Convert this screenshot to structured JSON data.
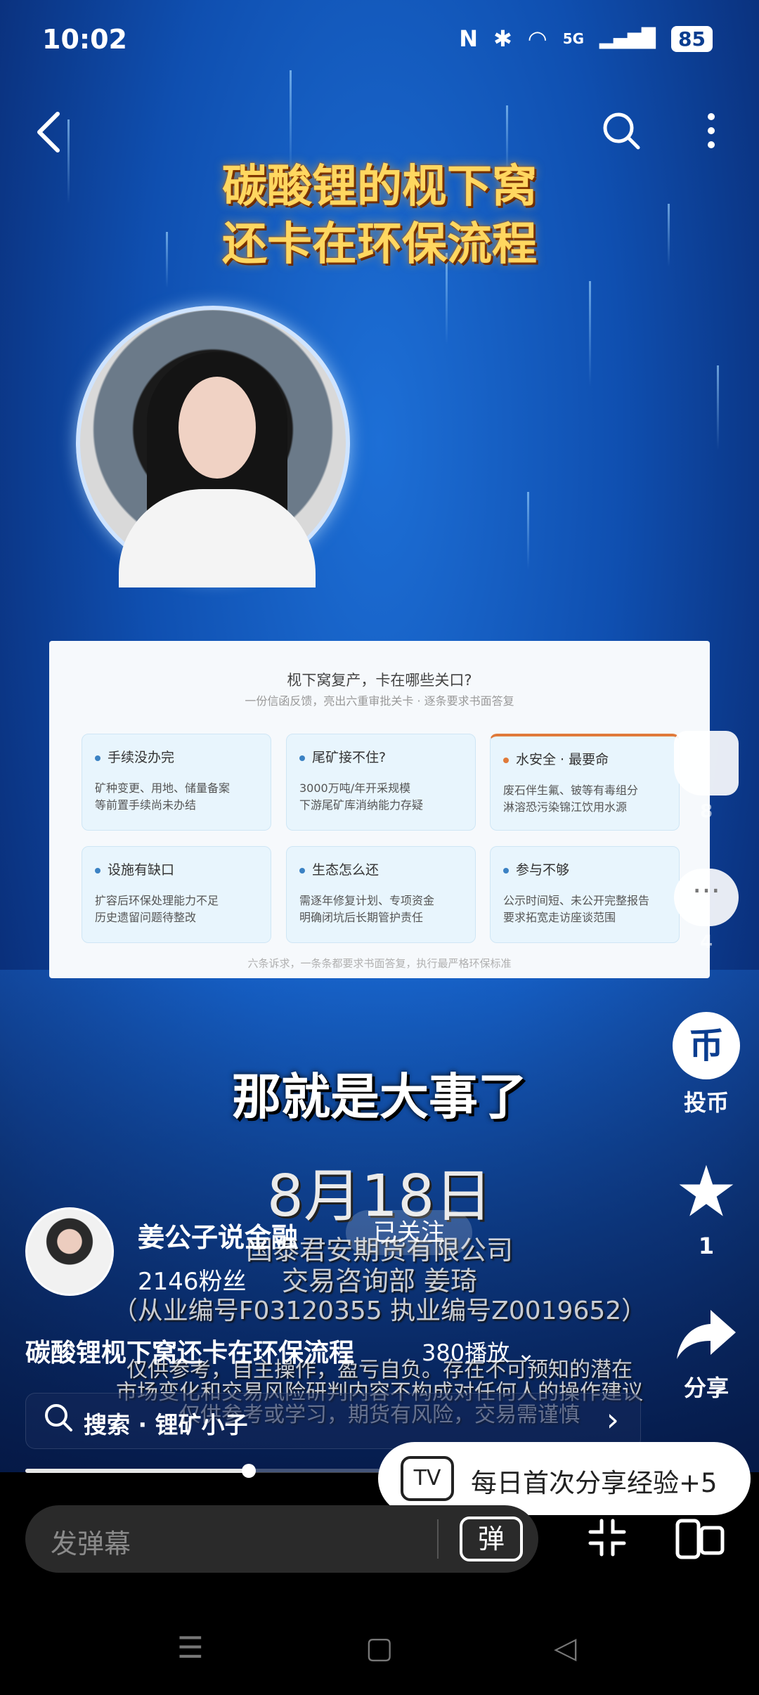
{
  "status_bar": {
    "time": "10:02",
    "nfc": "N",
    "bluetooth": "✱",
    "wifi": "◠",
    "network": "5G",
    "signal": "▂▄▆█",
    "battery": "85"
  },
  "video": {
    "title_art": "碳酸锂的枧下窝还卡在环保流程",
    "slide": {
      "title": "枧下窝复产，卡在哪些关口?",
      "subtitle": "一份信函反馈，亮出六重审批关卡 · 逐条要求书面答复",
      "cards": [
        {
          "title": "手续没办完",
          "line1": "矿种变更、用地、储量备案",
          "line2": "等前置手续尚未办结",
          "highlight": false
        },
        {
          "title": "尾矿接不住?",
          "line1": "3000万吨/年开采规模",
          "line2": "下游尾矿库消纳能力存疑",
          "highlight": false
        },
        {
          "title": "水安全 · 最要命",
          "line1": "废石伴生氟、铍等有毒组分",
          "line2": "淋溶恐污染锦江饮用水源",
          "highlight": true
        },
        {
          "title": "设施有缺口",
          "line1": "扩容后环保处理能力不足",
          "line2": "历史遗留问题待整改",
          "highlight": false
        },
        {
          "title": "生态怎么还",
          "line1": "需逐年修复计划、专项资金",
          "line2": "明确闭坑后长期管护责任",
          "highlight": false
        },
        {
          "title": "参与不够",
          "line1": "公示时间短、未公开完整报告",
          "line2": "要求拓宽走访座谈范围",
          "highlight": false
        }
      ],
      "footer": "六条诉求，一条条都要求书面答复，执行最严格环保标准"
    },
    "caption": "那就是大事了",
    "date": "8月18日",
    "disclaimer_company": "国泰君安期货有限公司",
    "disclaimer_dept": "交易咨询部 姜琦",
    "disclaimer_ids": "（从业编号F03120355 执业编号Z0019652）",
    "disclaimer_line4": "仅供参考，自主操作，盈亏自负。存在不可预知的潜在",
    "disclaimer_line5": "市场变化和交易风险研判内容不构成对任何人的操作建议",
    "disclaimer_line6": "仅供参考或学习，期货有风险，交易需谨慎"
  },
  "right_rail": {
    "like_count": "8",
    "comment_count": "4",
    "coin_icon": "币",
    "coin_label": "投币",
    "favorite_count": "1",
    "share_label": "分享"
  },
  "uploader": {
    "name": "姜公子说金融",
    "follow_label": "已关注",
    "fans": "2146粉丝"
  },
  "video_info": {
    "title": "碳酸锂枧下窝还卡在环保流程",
    "plays": "380播放"
  },
  "search": {
    "text": "搜索 · 锂矿小子"
  },
  "progress": {
    "fraction": 0.315
  },
  "toast": {
    "icon_text": "TV",
    "text": "每日首次分享经验+5"
  },
  "bottom": {
    "danmaku_placeholder": "发弹幕",
    "danmaku_icon": "弹"
  },
  "icons": {
    "back": "back-icon",
    "search": "search-icon",
    "more": "more-vertical-icon"
  }
}
